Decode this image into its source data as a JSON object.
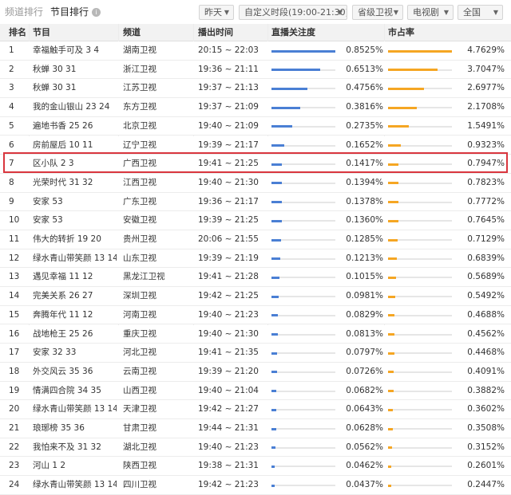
{
  "tabs": {
    "inactive": "频道排行",
    "active": "节目排行"
  },
  "filters": {
    "day": "昨天",
    "period": "自定义时段(19:00-21:30)",
    "channel_type": "省级卫视",
    "genre": "电视剧",
    "region": "全国"
  },
  "columns": {
    "rank": "排名",
    "program": "节目",
    "channel": "频道",
    "airtime": "播出时间",
    "rating": "直播关注度",
    "share": "市占率"
  },
  "rows": [
    {
      "rank": "1",
      "program": "幸福触手可及 3 4",
      "channel": "湖南卫视",
      "airtime": "20:15 ~ 22:03",
      "rating": "0.8525%",
      "rating_value": 0.8525,
      "share": "4.7629%",
      "share_value": 4.7629
    },
    {
      "rank": "2",
      "program": "秋蝉 30 31",
      "channel": "浙江卫视",
      "airtime": "19:36 ~ 21:11",
      "rating": "0.6513%",
      "rating_value": 0.6513,
      "share": "3.7047%",
      "share_value": 3.7047
    },
    {
      "rank": "3",
      "program": "秋蝉 30 31",
      "channel": "江苏卫视",
      "airtime": "19:37 ~ 21:13",
      "rating": "0.4756%",
      "rating_value": 0.4756,
      "share": "2.6977%",
      "share_value": 2.6977
    },
    {
      "rank": "4",
      "program": "我的金山银山 23 24",
      "channel": "东方卫视",
      "airtime": "19:37 ~ 21:09",
      "rating": "0.3816%",
      "rating_value": 0.3816,
      "share": "2.1708%",
      "share_value": 2.1708
    },
    {
      "rank": "5",
      "program": "遍地书香 25 26",
      "channel": "北京卫视",
      "airtime": "19:40 ~ 21:09",
      "rating": "0.2735%",
      "rating_value": 0.2735,
      "share": "1.5491%",
      "share_value": 1.5491
    },
    {
      "rank": "6",
      "program": "房前屋后 10 11",
      "channel": "辽宁卫视",
      "airtime": "19:39 ~ 21:17",
      "rating": "0.1652%",
      "rating_value": 0.1652,
      "share": "0.9323%",
      "share_value": 0.9323
    },
    {
      "rank": "7",
      "program": "区小队 2 3",
      "channel": "广西卫视",
      "airtime": "19:41 ~ 21:25",
      "rating": "0.1417%",
      "rating_value": 0.1417,
      "share": "0.7947%",
      "share_value": 0.7947
    },
    {
      "rank": "8",
      "program": "光荣时代 31 32",
      "channel": "江西卫视",
      "airtime": "19:40 ~ 21:30",
      "rating": "0.1394%",
      "rating_value": 0.1394,
      "share": "0.7823%",
      "share_value": 0.7823
    },
    {
      "rank": "9",
      "program": "安家 53",
      "channel": "广东卫视",
      "airtime": "19:36 ~ 21:17",
      "rating": "0.1378%",
      "rating_value": 0.1378,
      "share": "0.7772%",
      "share_value": 0.7772
    },
    {
      "rank": "10",
      "program": "安家 53",
      "channel": "安徽卫视",
      "airtime": "19:39 ~ 21:25",
      "rating": "0.1360%",
      "rating_value": 0.136,
      "share": "0.7645%",
      "share_value": 0.7645
    },
    {
      "rank": "11",
      "program": "伟大的转折 19 20",
      "channel": "贵州卫视",
      "airtime": "20:06 ~ 21:55",
      "rating": "0.1285%",
      "rating_value": 0.1285,
      "share": "0.7129%",
      "share_value": 0.7129
    },
    {
      "rank": "12",
      "program": "绿水青山带笑颜 13 14",
      "channel": "山东卫视",
      "airtime": "19:39 ~ 21:19",
      "rating": "0.1213%",
      "rating_value": 0.1213,
      "share": "0.6839%",
      "share_value": 0.6839
    },
    {
      "rank": "13",
      "program": "遇见幸福 11 12",
      "channel": "黑龙江卫视",
      "airtime": "19:41 ~ 21:28",
      "rating": "0.1015%",
      "rating_value": 0.1015,
      "share": "0.5689%",
      "share_value": 0.5689
    },
    {
      "rank": "14",
      "program": "完美关系 26 27",
      "channel": "深圳卫视",
      "airtime": "19:42 ~ 21:25",
      "rating": "0.0981%",
      "rating_value": 0.0981,
      "share": "0.5492%",
      "share_value": 0.5492
    },
    {
      "rank": "15",
      "program": "奔腾年代 11 12",
      "channel": "河南卫视",
      "airtime": "19:40 ~ 21:23",
      "rating": "0.0829%",
      "rating_value": 0.0829,
      "share": "0.4688%",
      "share_value": 0.4688
    },
    {
      "rank": "16",
      "program": "战地枪王 25 26",
      "channel": "重庆卫视",
      "airtime": "19:40 ~ 21:30",
      "rating": "0.0813%",
      "rating_value": 0.0813,
      "share": "0.4562%",
      "share_value": 0.4562
    },
    {
      "rank": "17",
      "program": "安家 32 33",
      "channel": "河北卫视",
      "airtime": "19:41 ~ 21:35",
      "rating": "0.0797%",
      "rating_value": 0.0797,
      "share": "0.4468%",
      "share_value": 0.4468
    },
    {
      "rank": "18",
      "program": "外交风云 35 36",
      "channel": "云南卫视",
      "airtime": "19:39 ~ 21:20",
      "rating": "0.0726%",
      "rating_value": 0.0726,
      "share": "0.4091%",
      "share_value": 0.4091
    },
    {
      "rank": "19",
      "program": "情满四合院 34 35",
      "channel": "山西卫视",
      "airtime": "19:40 ~ 21:04",
      "rating": "0.0682%",
      "rating_value": 0.0682,
      "share": "0.3882%",
      "share_value": 0.3882
    },
    {
      "rank": "20",
      "program": "绿水青山带笑颜 13 14",
      "channel": "天津卫视",
      "airtime": "19:42 ~ 21:27",
      "rating": "0.0643%",
      "rating_value": 0.0643,
      "share": "0.3602%",
      "share_value": 0.3602
    },
    {
      "rank": "21",
      "program": "琅琊榜 35 36",
      "channel": "甘肃卫视",
      "airtime": "19:44 ~ 21:31",
      "rating": "0.0628%",
      "rating_value": 0.0628,
      "share": "0.3508%",
      "share_value": 0.3508
    },
    {
      "rank": "22",
      "program": "我怕来不及 31 32",
      "channel": "湖北卫视",
      "airtime": "19:40 ~ 21:23",
      "rating": "0.0562%",
      "rating_value": 0.0562,
      "share": "0.3152%",
      "share_value": 0.3152
    },
    {
      "rank": "23",
      "program": "河山 1 2",
      "channel": "陕西卫视",
      "airtime": "19:38 ~ 21:31",
      "rating": "0.0462%",
      "rating_value": 0.0462,
      "share": "0.2601%",
      "share_value": 0.2601
    },
    {
      "rank": "24",
      "program": "绿水青山带笑颜 13 14",
      "channel": "四川卫视",
      "airtime": "19:42 ~ 21:23",
      "rating": "0.0437%",
      "rating_value": 0.0437,
      "share": "0.2447%",
      "share_value": 0.2447
    }
  ],
  "highlighted_rank": "7",
  "colors": {
    "rating_bar": "#4a7fd4",
    "share_bar": "#f5a623",
    "highlight_border": "#d9363e"
  },
  "icons": {
    "info": "info-icon",
    "caret": "caret-down-icon"
  }
}
